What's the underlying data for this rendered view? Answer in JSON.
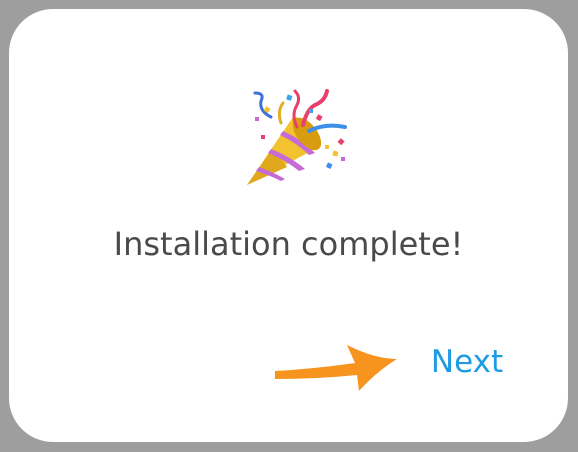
{
  "dialog": {
    "message": "Installation complete!",
    "next_label": "Next",
    "icon": "party-popper-icon",
    "pointer": "arrow-pointing-right-icon"
  },
  "colors": {
    "backdrop": "#9e9e9e",
    "dialog_bg": "#ffffff",
    "message_text": "#4a4a4a",
    "next_text": "#1e9be3",
    "arrow": "#f7941d"
  }
}
